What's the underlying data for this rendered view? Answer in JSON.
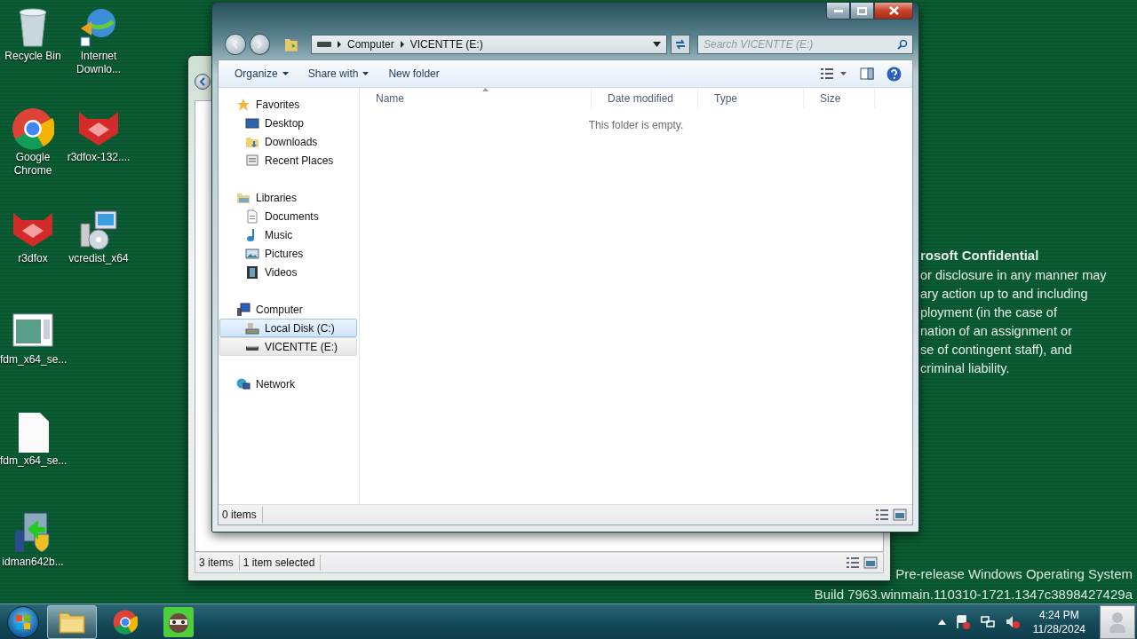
{
  "desktop": {
    "icon_rows": [
      {
        "icons": [
          {
            "kind": "recycle-bin",
            "label": "Recycle Bin"
          },
          {
            "kind": "globe-download",
            "label": "Internet Downlo..."
          }
        ]
      },
      {
        "icons": [
          {
            "kind": "chrome",
            "label": "Google Chrome"
          },
          {
            "kind": "fox",
            "label": "r3dfox-132...."
          }
        ]
      },
      {
        "icons": [
          {
            "kind": "fox",
            "label": "r3dfox"
          },
          {
            "kind": "installer",
            "label": "vcredist_x64"
          }
        ]
      },
      {
        "icons": [
          {
            "kind": "window-file",
            "label": "fdm_x64_se..."
          }
        ]
      },
      {
        "icons": [
          {
            "kind": "blank-file",
            "label": "fdm_x64_se..."
          }
        ]
      },
      {
        "icons": [
          {
            "kind": "shield-installer",
            "label": "idman642b..."
          }
        ]
      }
    ]
  },
  "notice": {
    "title": "rosoft Confidential",
    "lines": [
      "or disclosure in any manner may",
      "ary action up to and including",
      "ployment (in the case of",
      "nation of an assignment or",
      "se of contingent staff), and",
      "criminal liability."
    ]
  },
  "build_info": {
    "edition": "Pre-release Windows Operating System",
    "build": "Build 7963.winmain.110310-1721.1347c3898427429a"
  },
  "back_window": {
    "status": [
      "3 items",
      "1 item selected"
    ]
  },
  "explorer": {
    "breadcrumb": [
      "Computer",
      "VICENTTE (E:)"
    ],
    "search": {
      "placeholder": "Search VICENTTE (E:)"
    },
    "commands": [
      {
        "label": "Organize",
        "menu": true
      },
      {
        "label": "Share with",
        "menu": true
      },
      {
        "label": "New folder",
        "menu": false
      }
    ],
    "nav": [
      {
        "label": "Favorites",
        "kind": "favorites",
        "children": [
          {
            "label": "Desktop",
            "kind": "desktop",
            "selected": false,
            "hovered": false
          },
          {
            "label": "Downloads",
            "kind": "downloads",
            "selected": false,
            "hovered": false
          },
          {
            "label": "Recent Places",
            "kind": "recent",
            "selected": false,
            "hovered": false
          }
        ]
      },
      {
        "label": "Libraries",
        "kind": "libraries",
        "children": [
          {
            "label": "Documents",
            "kind": "documents",
            "selected": false,
            "hovered": false
          },
          {
            "label": "Music",
            "kind": "music",
            "selected": false,
            "hovered": false
          },
          {
            "label": "Pictures",
            "kind": "pictures",
            "selected": false,
            "hovered": false
          },
          {
            "label": "Videos",
            "kind": "videos",
            "selected": false,
            "hovered": false
          }
        ]
      },
      {
        "label": "Computer",
        "kind": "computer",
        "children": [
          {
            "label": "Local Disk (C:)",
            "kind": "disk",
            "selected": false,
            "hovered": true
          },
          {
            "label": "VICENTTE (E:)",
            "kind": "usb",
            "selected": true,
            "hovered": false
          }
        ]
      },
      {
        "label": "Network",
        "kind": "network"
      }
    ],
    "columns": [
      "Name",
      "Date modified",
      "Type",
      "Size"
    ],
    "empty_message": "This folder is empty.",
    "status": "0 items"
  },
  "taskbar": {
    "apps": [
      {
        "kind": "explorer",
        "selected": true
      },
      {
        "kind": "chrome",
        "selected": false
      },
      {
        "kind": "raccoon",
        "selected": false
      }
    ],
    "clock": {
      "time": "4:24 PM",
      "date": "11/28/2024"
    }
  }
}
